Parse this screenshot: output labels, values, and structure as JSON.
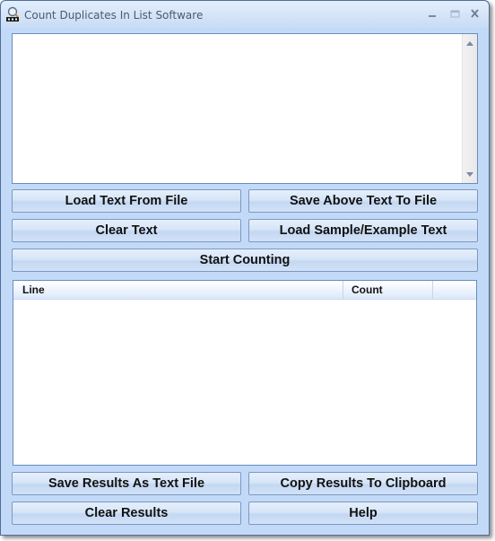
{
  "window": {
    "title": "Count Duplicates In List Software",
    "icon": "magnifier-app-icon",
    "controls": {
      "minimize": "minimize-icon",
      "maximize": "maximize-icon",
      "close": "close-icon"
    }
  },
  "input": {
    "value": "",
    "placeholder": ""
  },
  "buttons": {
    "load_text_from_file": "Load Text From File",
    "save_above_text_to_file": "Save Above Text To File",
    "clear_text": "Clear Text",
    "load_sample_text": "Load Sample/Example Text",
    "start_counting": "Start Counting",
    "save_results": "Save Results As Text File",
    "copy_results": "Copy Results To Clipboard",
    "clear_results": "Clear Results",
    "help": "Help"
  },
  "results": {
    "columns": [
      "Line",
      "Count"
    ],
    "rows": []
  },
  "colors": {
    "window_bg": "#c2daf7",
    "border": "#6a8cbf"
  }
}
